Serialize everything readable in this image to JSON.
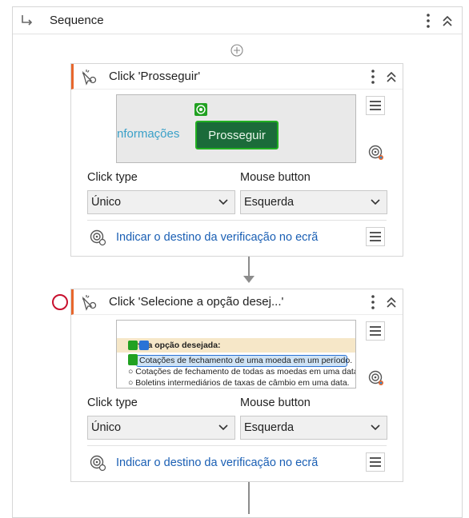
{
  "sequence": {
    "title": "Sequence"
  },
  "activities": [
    {
      "title": "Click 'Prosseguir'",
      "preview": {
        "left_text": "nformações",
        "button_text": "Prosseguir"
      },
      "click_type_label": "Click type",
      "click_type_value": "Único",
      "mouse_button_label": "Mouse button",
      "mouse_button_value": "Esquerda",
      "indicate_link": "Indicar o destino da verificação no ecrã"
    },
    {
      "title": "Click 'Selecione a opção desej...'",
      "preview": {
        "heading": "ione a opção desejada:",
        "options": [
          "Cotações de fechamento de uma moeda em um período.",
          "Cotações de fechamento de todas as moedas em uma data",
          "Boletins intermediários de taxas de câmbio em uma data."
        ]
      },
      "click_type_label": "Click type",
      "click_type_value": "Único",
      "mouse_button_label": "Mouse button",
      "mouse_button_value": "Esquerda",
      "indicate_link": "Indicar o destino da verificação no ecrã"
    }
  ],
  "colors": {
    "accent": "#e8672d",
    "link": "#1a5fb4",
    "breakpoint": "#c8102e",
    "target_green": "#21a121"
  },
  "icons": [
    "sequence-arrow-icon",
    "kebab-icon",
    "collapse-icon",
    "add-icon",
    "click-activity-icon",
    "hamburger-icon",
    "target-icon",
    "chevron-down-icon",
    "anchor-icon"
  ]
}
